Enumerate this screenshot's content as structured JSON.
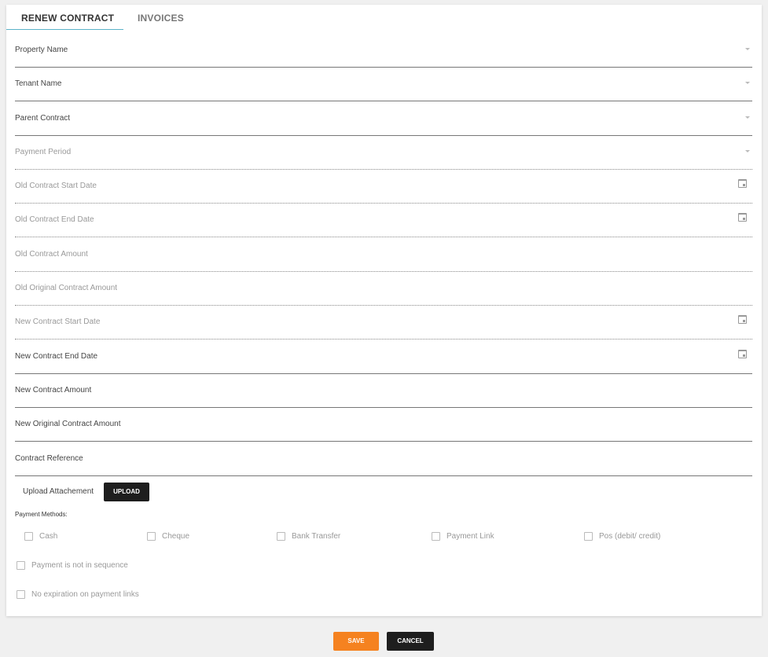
{
  "tabs": [
    {
      "label": "RENEW CONTRACT",
      "active": true
    },
    {
      "label": "INVOICES",
      "active": false
    }
  ],
  "fields": {
    "property_name": "Property Name",
    "tenant_name": "Tenant Name",
    "parent_contract": "Parent Contract",
    "payment_period": "Payment Period",
    "old_start": "Old Contract Start Date",
    "old_end": "Old Contract End Date",
    "old_amount": "Old Contract Amount",
    "old_original_amount": "Old Original Contract Amount",
    "new_start": "New Contract Start Date",
    "new_end": "New Contract End Date",
    "new_amount": "New Contract Amount",
    "new_original_amount": "New Original Contract Amount",
    "contract_reference": "Contract Reference"
  },
  "upload": {
    "label": "Upload Attachement",
    "button": "UPLOAD"
  },
  "payment_methods": {
    "title": "Payment Methods:",
    "options": [
      "Cash",
      "Cheque",
      "Bank Transfer",
      "Payment Link",
      "Pos (debit/ credit)"
    ]
  },
  "options": {
    "not_in_sequence": "Payment is not in sequence",
    "no_expiration": "No expiration on payment links"
  },
  "actions": {
    "save": "SAVE",
    "cancel": "CANCEL"
  },
  "colors": {
    "accent": "#5bb3c8",
    "save": "#f58220",
    "dark_button": "#1e1e1e"
  }
}
